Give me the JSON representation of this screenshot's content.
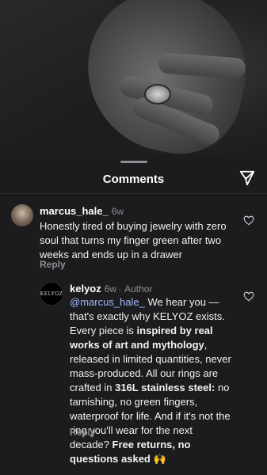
{
  "sheet": {
    "title": "Comments"
  },
  "comments": [
    {
      "username": "marcus_hale_",
      "time": "6w",
      "text": "Honestly tired of buying jewelry with zero soul that turns my finger green after two weeks and ends up in a drawer",
      "reply_label": "Reply"
    }
  ],
  "reply": {
    "username": "kelyoz",
    "time": "6w",
    "badge": "Author",
    "avatar_text": "KELYOZ",
    "mention": "@marcus_hale_",
    "part1": " We hear you — that's exactly why KELYOZ exists. Every piece is ",
    "bold1": "inspired by real works of art and mythology",
    "part2": ", released in limited quantities, never mass-produced. All our rings are crafted in ",
    "bold2": "316L stainless steel:",
    "part3": " no tarnishing, no green fingers, waterproof for life. And if it's not the ring you'll wear for the next decade? ",
    "bold3": "Free returns, no questions asked",
    "emoji": "🙌",
    "reply_label": "Reply"
  },
  "icons": [
    "share-icon",
    "heart-icon"
  ]
}
